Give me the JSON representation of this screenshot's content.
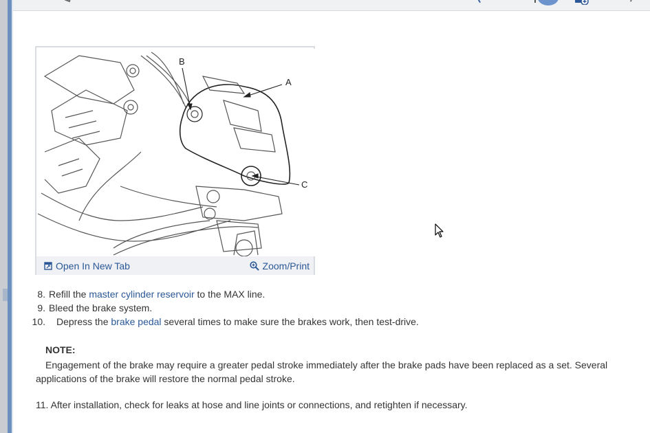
{
  "figure": {
    "callouts": [
      "A",
      "B",
      "C"
    ],
    "open_tab_label": "Open In New Tab",
    "zoom_label": "Zoom/Print"
  },
  "steps": [
    {
      "num": "8.",
      "before": "Refill the ",
      "link": "master cylinder reservoir",
      "after": " to the MAX line."
    },
    {
      "num": "9.",
      "before": "Bleed the brake system.",
      "link": "",
      "after": ""
    },
    {
      "num": "10.",
      "before": "Depress the ",
      "link": "brake pedal",
      "after": " several times to make sure the brakes work, then test-drive."
    }
  ],
  "note": {
    "title": "NOTE:",
    "body": "Engagement of the brake may require a greater pedal stroke immediately after the brake pads have been replaced as a set. Several applications of the brake will restore the normal pedal stroke."
  },
  "step11": {
    "num": "11.",
    "text": "After installation, check for leaks at hose and line joints or connections, and retighten if necessary."
  },
  "colors": {
    "link": "#2b5797",
    "text": "#333333",
    "figure_bar": "#eff1f4",
    "accent_edge": "#6b8fbf"
  }
}
